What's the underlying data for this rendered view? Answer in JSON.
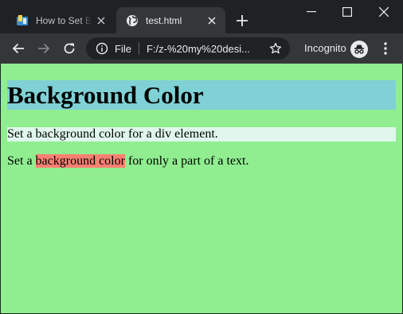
{
  "browser": {
    "tabs": [
      {
        "label": "How to Set Background Color",
        "active": false
      },
      {
        "label": "test.html",
        "active": true
      }
    ],
    "address": {
      "scheme": "File",
      "url": "F:/z-%20my%20desi..."
    },
    "incognito_label": "Incognito",
    "colors": {
      "titlebar": "#202124",
      "toolbar": "#35363a",
      "omnibox": "#202124"
    }
  },
  "page": {
    "heading": "Background Color",
    "div_paragraph": "Set a background color for a div element.",
    "text_before": "Set a ",
    "highlighted": "background color",
    "text_after": " for only a part of a text.",
    "colors": {
      "body_background": "#90ee90",
      "heading_background": "#7fd1d5",
      "div_background": "#e0f8ec",
      "span_background": "#fa8072"
    }
  }
}
